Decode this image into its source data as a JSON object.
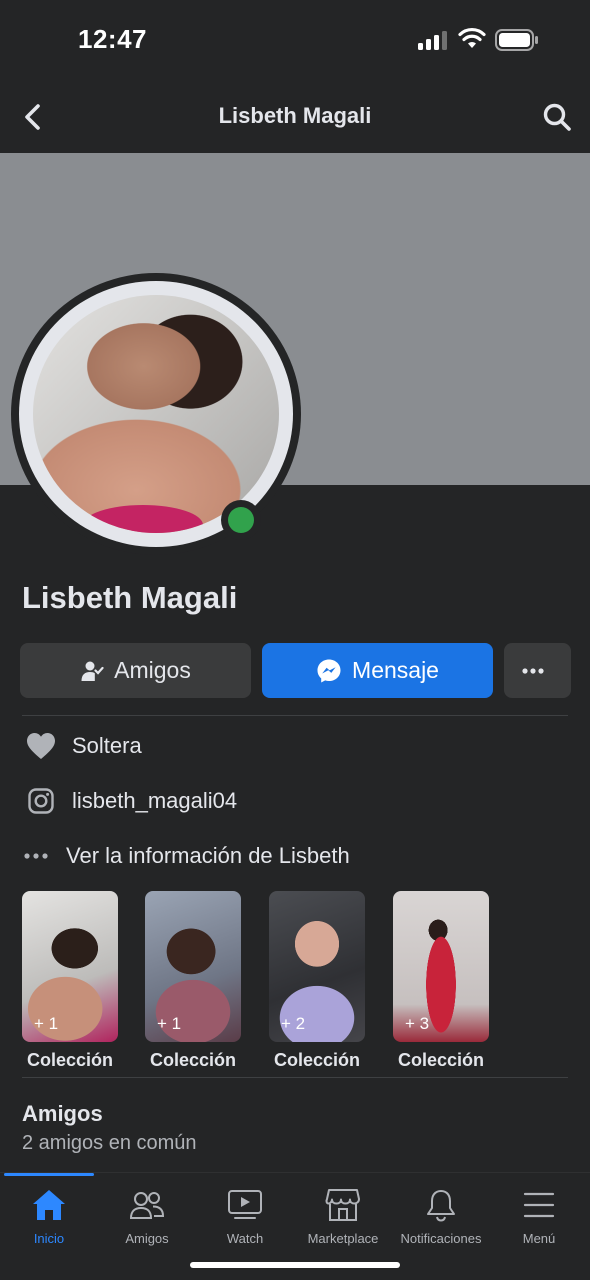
{
  "status_bar": {
    "time": "12:47",
    "icons": [
      "signal-icon",
      "wifi-icon",
      "battery-icon"
    ]
  },
  "header": {
    "title": "Lisbeth Magali",
    "back_icon": "chevron-left-icon",
    "search_icon": "search-icon"
  },
  "profile": {
    "name": "Lisbeth Magali",
    "online": true
  },
  "actions": {
    "friends_label": "Amigos",
    "message_label": "Mensaje",
    "more_icon": "ellipsis-icon"
  },
  "info": {
    "relationship": "Soltera",
    "instagram": "lisbeth_magali04",
    "see_info": "Ver la información de Lisbeth"
  },
  "collections": [
    {
      "label": "Colección",
      "count": "+ 1"
    },
    {
      "label": "Colección",
      "count": "+ 1"
    },
    {
      "label": "Colección",
      "count": "+ 2"
    },
    {
      "label": "Colección",
      "count": "+ 3"
    }
  ],
  "friends": {
    "title": "Amigos",
    "subtitle": "2 amigos en común"
  },
  "bottom_nav": {
    "items": [
      {
        "label": "Inicio",
        "icon": "home-icon",
        "active": true
      },
      {
        "label": "Amigos",
        "icon": "friends-icon",
        "active": false
      },
      {
        "label": "Watch",
        "icon": "watch-icon",
        "active": false
      },
      {
        "label": "Marketplace",
        "icon": "marketplace-icon",
        "active": false
      },
      {
        "label": "Notificaciones",
        "icon": "bell-icon",
        "active": false
      },
      {
        "label": "Menú",
        "icon": "menu-icon",
        "active": false
      }
    ]
  },
  "colors": {
    "background": "#242526",
    "accent": "#1b74e4",
    "online": "#31a24c",
    "active_nav": "#2d88ff"
  }
}
